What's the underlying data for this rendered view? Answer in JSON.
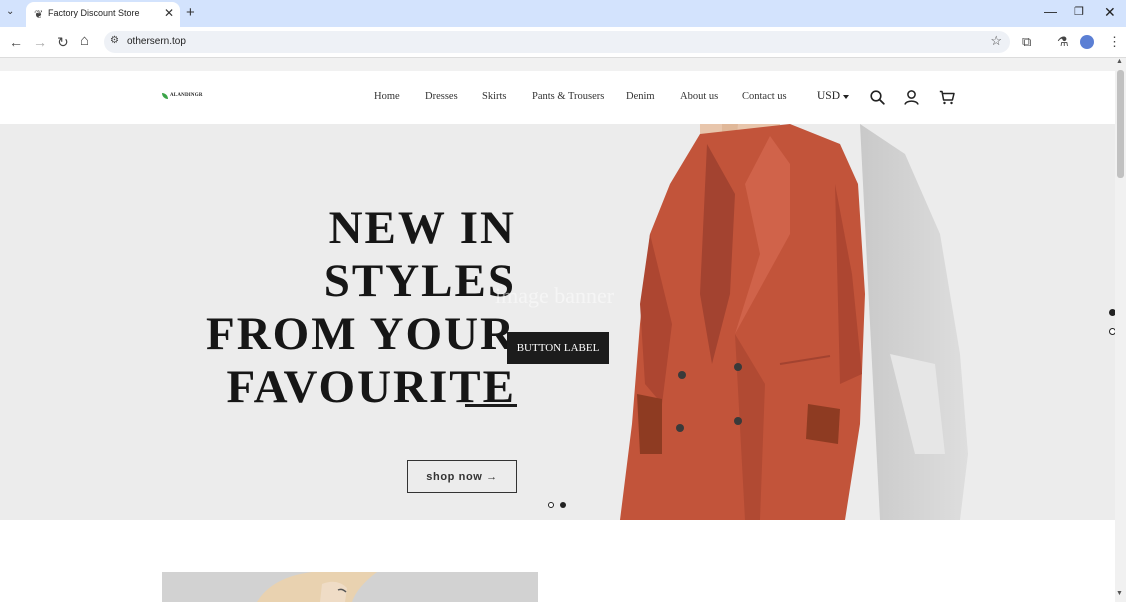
{
  "browser": {
    "tab_title": "Factory Discount Store",
    "url": "othersern.top",
    "tab_close": "✕",
    "new_tab": "+",
    "tab_list": "⌄",
    "minimize": "—",
    "restore": "❐",
    "close": "✕",
    "back": "←",
    "forward": "→",
    "reload": "↻",
    "home": "⌂",
    "site_info": "⚙",
    "bookmark": "☆",
    "extensions": "⧉",
    "labs": "⚗",
    "menu": "⋮"
  },
  "header": {
    "logo_text": "ALANDINGR",
    "nav": [
      "Home",
      "Dresses",
      "Skirts",
      "Pants & Trousers",
      "Denim",
      "About us",
      "Contact us"
    ],
    "currency": "USD"
  },
  "hero": {
    "title_lines": [
      "NEW IN STYLES",
      "FROM YOUR",
      "FAVOURITE"
    ],
    "watermark": "image banner",
    "button_label": "BUTTON LABEL",
    "shop_label": "shop now →",
    "slides_total": 2,
    "active_slide": 2
  },
  "colors": {
    "jacket": "#c2543a",
    "hero_bg": "#ececec",
    "button_bg": "#1c1c1c",
    "tab_strip": "#d3e3fd"
  }
}
